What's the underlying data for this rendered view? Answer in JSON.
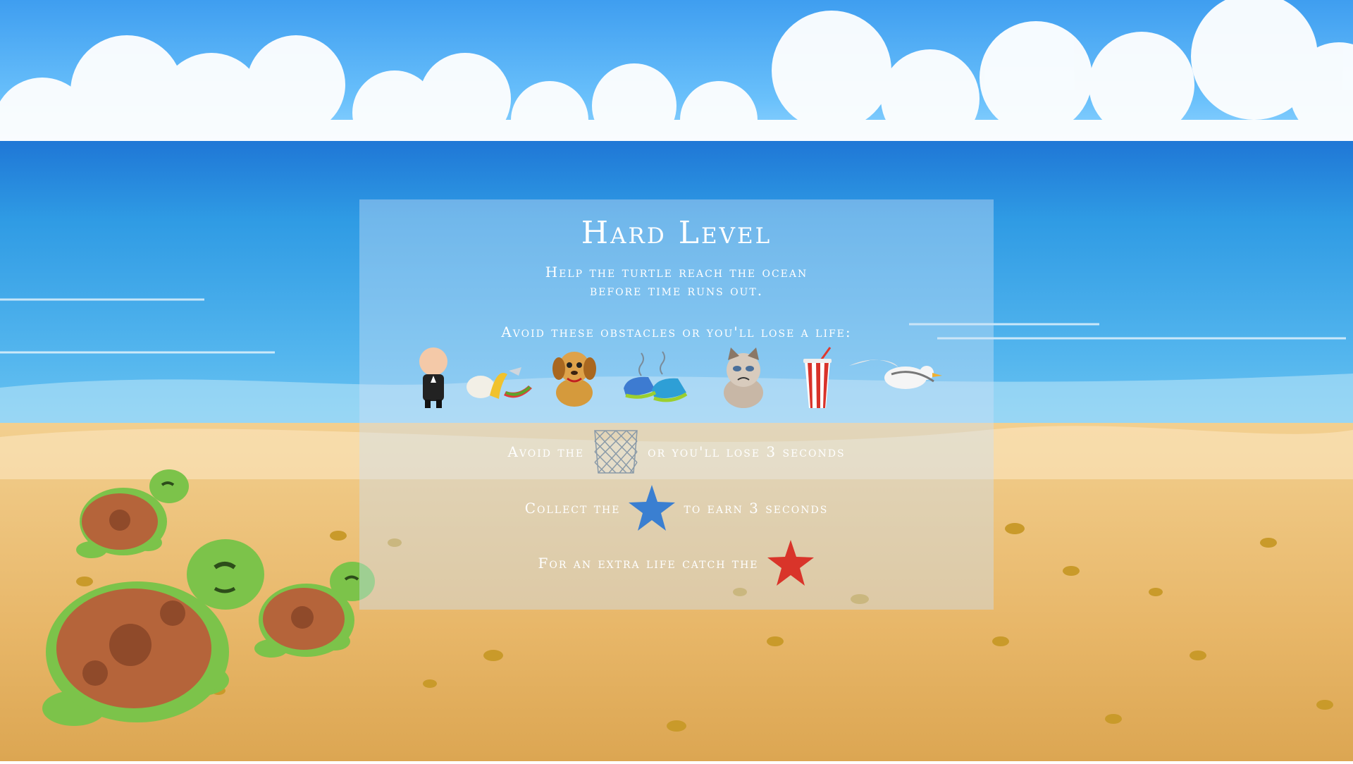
{
  "level": {
    "title": "Hard Level",
    "intro_line1": "Help the turtle reach the ocean",
    "intro_line2": "before time runs out."
  },
  "obstacles": {
    "caption": "Avoid these obstacles or you'll lose a life:",
    "items": [
      {
        "icon": "baby-in-suit-icon"
      },
      {
        "icon": "food-scraps-icon"
      },
      {
        "icon": "dog-icon"
      },
      {
        "icon": "smelly-sneakers-icon"
      },
      {
        "icon": "grumpy-cat-icon"
      },
      {
        "icon": "soda-cup-icon"
      },
      {
        "icon": "seagull-icon"
      }
    ]
  },
  "rules": {
    "net": {
      "before": "Avoid the",
      "after": "or you'll lose 3 seconds",
      "icon": "fishing-net-icon"
    },
    "blue_star": {
      "before": "Collect the",
      "after": "to earn 3 seconds",
      "icon": "blue-starfish-icon",
      "color": "#3a7fd1"
    },
    "red_star": {
      "before": "For an extra life catch the",
      "icon": "red-starfish-icon",
      "color": "#d9342a"
    }
  },
  "colors": {
    "panel_text": "#ffffff",
    "turtle_shell": "#b5643a",
    "turtle_skin": "#7cc34a"
  }
}
